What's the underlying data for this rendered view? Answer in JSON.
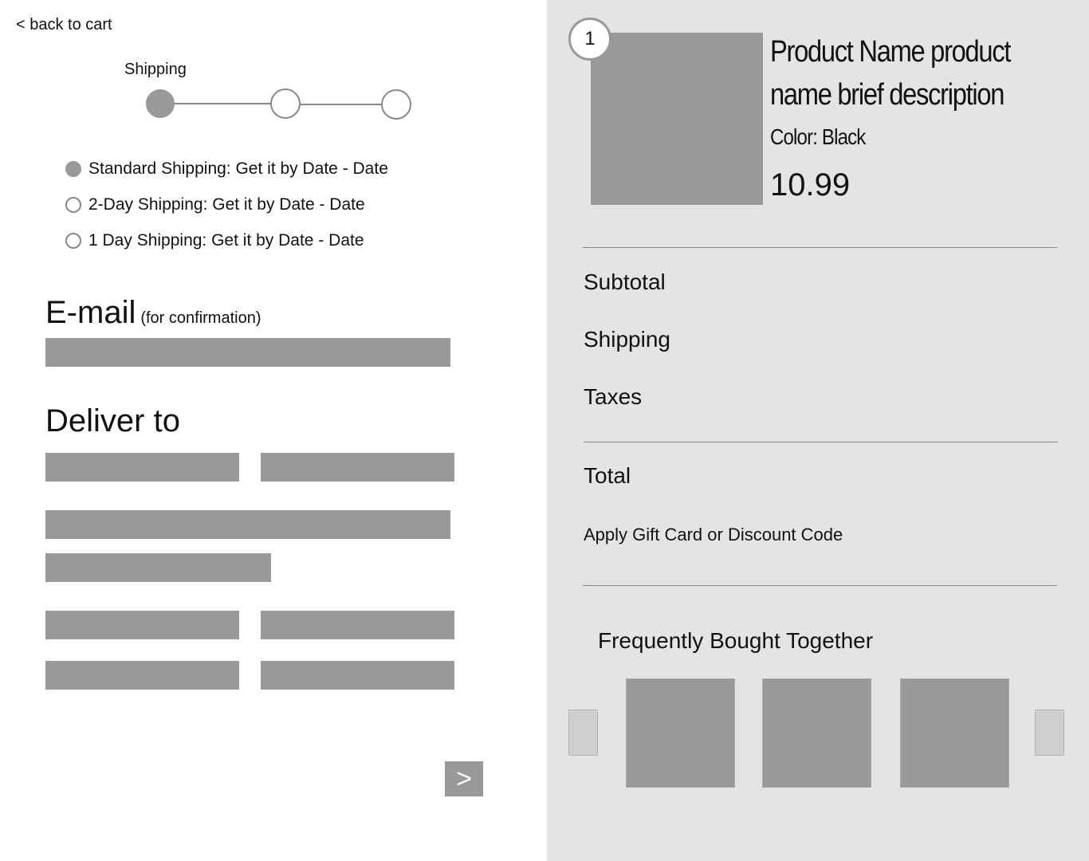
{
  "checkout": {
    "back_link": "< back to cart",
    "step_label": "Shipping",
    "shipping_options": [
      {
        "label": "Standard Shipping: Get it by Date - Date",
        "selected": true
      },
      {
        "label": "2-Day Shipping: Get it by Date - Date",
        "selected": false
      },
      {
        "label": "1 Day Shipping: Get it by Date - Date",
        "selected": false
      }
    ],
    "email_heading": "E-mail",
    "email_note": "(for confirmation)",
    "deliver_heading": "Deliver to",
    "next_label": ">"
  },
  "order": {
    "quantity": "1",
    "product_name": "Product Name product name brief description",
    "product_color": "Color: Black",
    "product_price": "10.99",
    "subtotal_label": "Subtotal",
    "shipping_label": "Shipping",
    "taxes_label": "Taxes",
    "total_label": "Total",
    "gift_label": "Apply Gift Card or Discount Code",
    "fbt_heading": "Frequently Bought Together"
  },
  "colors": {
    "panel_bg": "#e4e4e4",
    "placeholder_gray": "#999999",
    "page_bg": "#ffffff"
  }
}
